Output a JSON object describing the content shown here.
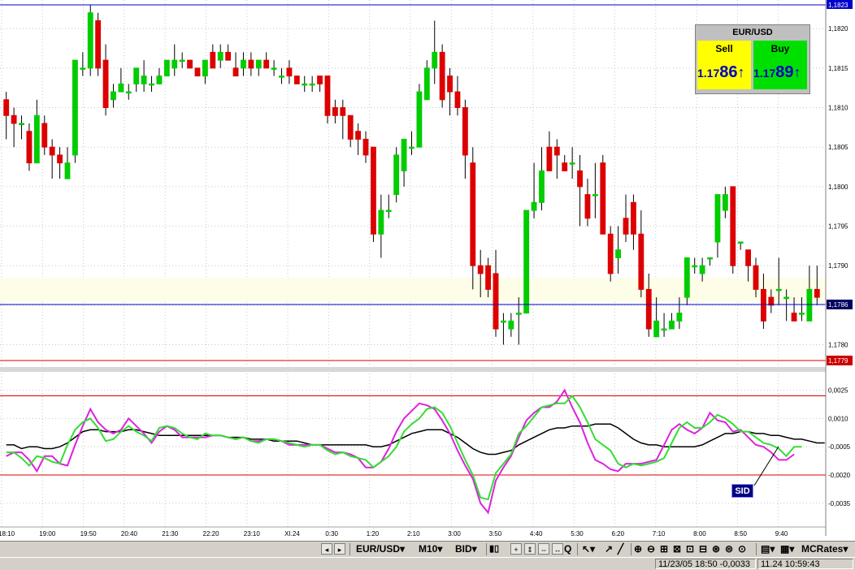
{
  "quote": {
    "symbol": "EUR/USD",
    "sell_label": "Sell",
    "buy_label": "Buy",
    "sell_prefix": "1.17",
    "sell_big": "86",
    "buy_prefix": "1.17",
    "buy_big": "89",
    "arrow": "↑"
  },
  "price_axis": {
    "labels": [
      "1,1820",
      "1,1815",
      "1,1810",
      "1,1805",
      "1,1800",
      "1,1795",
      "1,1790",
      "1,1785",
      "1,1780"
    ],
    "top_badge": "1,1823",
    "current_badge": "1,1786",
    "low_badge": "1,1779"
  },
  "indicator_axis": {
    "labels": [
      "0,0025",
      "0,0010",
      "-0,0005",
      "-0,0020",
      "-0,0035"
    ],
    "tag": "SID"
  },
  "time_axis": {
    "labels": [
      "18:10",
      "19:00",
      "19:50",
      "20:40",
      "21:30",
      "22:20",
      "23:10",
      "XI.24",
      "0:30",
      "1:20",
      "2:10",
      "3:00",
      "3:50",
      "4:40",
      "5:30",
      "6:20",
      "7:10",
      "8:00",
      "8:50",
      "9:40"
    ]
  },
  "toolbar": {
    "symbol": "EUR/USD",
    "timeframe": "M10",
    "price_type": "BID",
    "feed": "MCRates"
  },
  "status": {
    "info": "11/23/05 18:50  -0,0033",
    "clock": "11.24 10:59:43"
  },
  "colors": {
    "bull": "#00cc00",
    "bear": "#dd0000",
    "grid": "#c8c8c8",
    "sid_green": "#33dd33",
    "sid_magenta": "#dd22dd",
    "current_line": "#0000cc"
  },
  "chart_data": {
    "type": "candlestick",
    "symbol": "EUR/USD",
    "timeframe": "M10",
    "ylim": [
      1.1778,
      1.1823
    ],
    "candles": [
      [
        1.1811,
        1.1812,
        1.1806,
        1.1809
      ],
      [
        1.1809,
        1.181,
        1.1805,
        1.1808
      ],
      [
        1.1808,
        1.1809,
        1.1806,
        1.1808
      ],
      [
        1.1807,
        1.1808,
        1.1802,
        1.1803
      ],
      [
        1.1803,
        1.1811,
        1.1803,
        1.1809
      ],
      [
        1.1808,
        1.1809,
        1.1804,
        1.1805
      ],
      [
        1.1805,
        1.1806,
        1.1801,
        1.1804
      ],
      [
        1.1804,
        1.1805,
        1.1801,
        1.1803
      ],
      [
        1.1801,
        1.1805,
        1.1801,
        1.1803
      ],
      [
        1.1804,
        1.1814,
        1.1803,
        1.1816
      ],
      [
        1.1815,
        1.1817,
        1.1814,
        1.1815
      ],
      [
        1.1815,
        1.1823,
        1.1814,
        1.1822
      ],
      [
        1.1821,
        1.1822,
        1.1814,
        1.1815
      ],
      [
        1.1816,
        1.1818,
        1.1809,
        1.181
      ],
      [
        1.1811,
        1.1813,
        1.181,
        1.1812
      ],
      [
        1.1812,
        1.1815,
        1.1812,
        1.1813
      ],
      [
        1.1812,
        1.1813,
        1.1811,
        1.1812
      ],
      [
        1.1813,
        1.1815,
        1.1812,
        1.1815
      ],
      [
        1.1813,
        1.1816,
        1.1812,
        1.1814
      ],
      [
        1.1813,
        1.1814,
        1.1812,
        1.1813
      ],
      [
        1.1813,
        1.1815,
        1.1813,
        1.1814
      ],
      [
        1.1814,
        1.1816,
        1.1814,
        1.1816
      ],
      [
        1.1815,
        1.1818,
        1.1814,
        1.1816
      ],
      [
        1.1816,
        1.1817,
        1.1815,
        1.1816
      ],
      [
        1.1816,
        1.1816,
        1.1815,
        1.1815
      ],
      [
        1.1815,
        1.1815,
        1.1814,
        1.1814
      ],
      [
        1.1814,
        1.1816,
        1.1813,
        1.1816
      ],
      [
        1.1817,
        1.1818,
        1.1815,
        1.1815
      ],
      [
        1.1816,
        1.1818,
        1.1815,
        1.1817
      ],
      [
        1.1817,
        1.1818,
        1.1816,
        1.1816
      ],
      [
        1.1815,
        1.1817,
        1.1815,
        1.1814
      ],
      [
        1.1815,
        1.1817,
        1.1814,
        1.1816
      ],
      [
        1.1816,
        1.1817,
        1.1814,
        1.1815
      ],
      [
        1.1815,
        1.1816,
        1.1814,
        1.1816
      ],
      [
        1.1816,
        1.1817,
        1.1815,
        1.1815
      ],
      [
        1.1815,
        1.1816,
        1.1814,
        1.1815
      ],
      [
        1.1814,
        1.1815,
        1.1813,
        1.1814
      ],
      [
        1.1815,
        1.1816,
        1.1813,
        1.1814
      ],
      [
        1.1814,
        1.1814,
        1.1813,
        1.1813
      ],
      [
        1.1813,
        1.1814,
        1.1812,
        1.1813
      ],
      [
        1.1813,
        1.1814,
        1.1812,
        1.1813
      ],
      [
        1.1814,
        1.1814,
        1.1812,
        1.1813
      ],
      [
        1.1814,
        1.1814,
        1.1808,
        1.1809
      ],
      [
        1.181,
        1.1811,
        1.1808,
        1.1809
      ],
      [
        1.181,
        1.1811,
        1.1806,
        1.1809
      ],
      [
        1.1809,
        1.1809,
        1.1805,
        1.1806
      ],
      [
        1.1807,
        1.1808,
        1.1804,
        1.1806
      ],
      [
        1.1806,
        1.1807,
        1.1803,
        1.1804
      ],
      [
        1.1805,
        1.1805,
        1.1793,
        1.1794
      ],
      [
        1.1794,
        1.1799,
        1.1791,
        1.1797
      ],
      [
        1.1797,
        1.1799,
        1.1796,
        1.1797
      ],
      [
        1.1799,
        1.1805,
        1.1798,
        1.1804
      ],
      [
        1.1802,
        1.1806,
        1.18,
        1.1806
      ],
      [
        1.1805,
        1.1807,
        1.1804,
        1.1805
      ],
      [
        1.1805,
        1.1813,
        1.1805,
        1.1812
      ],
      [
        1.1811,
        1.1816,
        1.1811,
        1.1815
      ],
      [
        1.1815,
        1.1821,
        1.1813,
        1.1817
      ],
      [
        1.1817,
        1.1818,
        1.181,
        1.1811
      ],
      [
        1.1814,
        1.1815,
        1.1809,
        1.1812
      ],
      [
        1.1812,
        1.1814,
        1.1809,
        1.181
      ],
      [
        1.181,
        1.1811,
        1.1801,
        1.1804
      ],
      [
        1.1803,
        1.1805,
        1.1787,
        1.179
      ],
      [
        1.179,
        1.1792,
        1.1786,
        1.1789
      ],
      [
        1.179,
        1.1791,
        1.1786,
        1.1787
      ],
      [
        1.1789,
        1.1792,
        1.1781,
        1.1782
      ],
      [
        1.1783,
        1.1784,
        1.178,
        1.1783
      ],
      [
        1.1782,
        1.1784,
        1.1781,
        1.1783
      ],
      [
        1.1784,
        1.1786,
        1.178,
        1.1784
      ],
      [
        1.1784,
        1.1797,
        1.1784,
        1.1797
      ],
      [
        1.1797,
        1.1803,
        1.1796,
        1.1798
      ],
      [
        1.1798,
        1.1805,
        1.1797,
        1.1802
      ],
      [
        1.1805,
        1.1807,
        1.1802,
        1.1802
      ],
      [
        1.1805,
        1.1806,
        1.1801,
        1.1804
      ],
      [
        1.1803,
        1.1804,
        1.1802,
        1.1802
      ],
      [
        1.1803,
        1.1805,
        1.1801,
        1.1803
      ],
      [
        1.1802,
        1.1804,
        1.1795,
        1.18
      ],
      [
        1.1799,
        1.1801,
        1.1795,
        1.1796
      ],
      [
        1.1799,
        1.1803,
        1.1796,
        1.1799
      ],
      [
        1.1803,
        1.1804,
        1.1795,
        1.1794
      ],
      [
        1.1794,
        1.1795,
        1.1788,
        1.1789
      ],
      [
        1.1791,
        1.1795,
        1.1789,
        1.1792
      ],
      [
        1.1796,
        1.1799,
        1.1793,
        1.1794
      ],
      [
        1.1798,
        1.1799,
        1.1792,
        1.1794
      ],
      [
        1.1794,
        1.1797,
        1.1786,
        1.1787
      ],
      [
        1.1787,
        1.1789,
        1.1781,
        1.1782
      ],
      [
        1.1781,
        1.1786,
        1.1781,
        1.1783
      ],
      [
        1.1782,
        1.1784,
        1.1781,
        1.1782
      ],
      [
        1.1782,
        1.1784,
        1.1782,
        1.1783
      ],
      [
        1.1783,
        1.1786,
        1.1782,
        1.1784
      ],
      [
        1.1786,
        1.179,
        1.1785,
        1.1791
      ],
      [
        1.179,
        1.1791,
        1.1789,
        1.179
      ],
      [
        1.1789,
        1.1791,
        1.1788,
        1.179
      ],
      [
        1.1791,
        1.1791,
        1.179,
        1.1791
      ],
      [
        1.1793,
        1.1799,
        1.1791,
        1.1799
      ],
      [
        1.1797,
        1.18,
        1.1796,
        1.1799
      ],
      [
        1.18,
        1.18,
        1.1789,
        1.179
      ],
      [
        1.1793,
        1.1793,
        1.1792,
        1.1793
      ],
      [
        1.1792,
        1.1792,
        1.1788,
        1.179
      ],
      [
        1.179,
        1.1791,
        1.1786,
        1.1787
      ],
      [
        1.1787,
        1.1789,
        1.1782,
        1.1783
      ],
      [
        1.1786,
        1.1787,
        1.1784,
        1.1785
      ],
      [
        1.1787,
        1.1791,
        1.1785,
        1.1787
      ],
      [
        1.1786,
        1.1787,
        1.1783,
        1.1786
      ],
      [
        1.1784,
        1.1786,
        1.1783,
        1.1783
      ],
      [
        1.1784,
        1.1786,
        1.1783,
        1.1784
      ],
      [
        1.1783,
        1.179,
        1.1783,
        1.1787
      ],
      [
        1.1787,
        1.179,
        1.1785,
        1.1786
      ]
    ],
    "current_price": 1.1786,
    "low_line": 1.1779,
    "top_line": 1.1823,
    "indicator": {
      "name": "SID",
      "ylim": [
        -0.0042,
        0.003
      ],
      "levels": [
        0.0022,
        -0.002
      ],
      "black": [
        -0.0004,
        -0.0004,
        -0.0006,
        -0.0005,
        -0.0005,
        -0.0006,
        -0.0006,
        -0.0005,
        -0.0003,
        0.0,
        0.0003,
        0.0004,
        0.0004,
        0.0003,
        0.0003,
        0.0003,
        0.0004,
        0.0004,
        0.0003,
        0.0002,
        0.0001,
        0.0001,
        0.0001,
        0.0001,
        0.0001,
        0.0001,
        0.0001,
        0.0001,
        0.0001,
        0.0,
        0.0,
        0.0,
        -0.0001,
        -0.0001,
        -0.0001,
        -0.0002,
        -0.0002,
        -0.0002,
        -0.0002,
        -0.0003,
        -0.0004,
        -0.0004,
        -0.0004,
        -0.0004,
        -0.0004,
        -0.0004,
        -0.0004,
        -0.0004,
        -0.0005,
        -0.0005,
        -0.0004,
        -0.0002,
        0.0,
        0.0002,
        0.0003,
        0.0004,
        0.0004,
        0.0004,
        0.0002,
        0.0,
        -0.0003,
        -0.0006,
        -0.0008,
        -0.0009,
        -0.0009,
        -0.0008,
        -0.0007,
        -0.0004,
        -0.0002,
        0.0,
        0.0002,
        0.0004,
        0.0005,
        0.0005,
        0.0006,
        0.0006,
        0.0006,
        0.0007,
        0.0007,
        0.0007,
        0.0005,
        0.0002,
        -0.0001,
        -0.0003,
        -0.0004,
        -0.0004,
        -0.0005,
        -0.0005,
        -0.0005,
        -0.0005,
        -0.0005,
        -0.0004,
        -0.0002,
        0.0,
        0.0002,
        0.0002,
        0.0003,
        0.0003,
        0.0002,
        0.0002,
        0.0001,
        0.0001,
        0.0,
        -0.0001,
        -0.0001,
        -0.0002,
        -0.0003,
        -0.0003
      ],
      "green": [
        -0.0008,
        -0.0008,
        -0.0011,
        -0.0015,
        -0.001,
        -0.0011,
        -0.0013,
        -0.0014,
        -0.0004,
        0.0004,
        0.0008,
        0.001,
        0.0005,
        -0.0002,
        -0.0001,
        0.0003,
        0.0006,
        0.0003,
        0.0001,
        -0.0002,
        0.0005,
        0.0006,
        0.0005,
        0.0002,
        0.0,
        -0.0001,
        0.0002,
        0.0001,
        0.0001,
        0.0,
        -0.0001,
        0.0,
        -0.0002,
        -0.0003,
        -0.0001,
        -0.0001,
        -0.0002,
        -0.0003,
        -0.0004,
        -0.0005,
        -0.0004,
        -0.0004,
        -0.0007,
        -0.0009,
        -0.0008,
        -0.001,
        -0.0011,
        -0.0012,
        -0.0016,
        -0.0013,
        -0.001,
        -0.0005,
        0.0003,
        0.0007,
        0.001,
        0.0015,
        0.0016,
        0.0013,
        0.0006,
        -0.0003,
        -0.0012,
        -0.002,
        -0.0032,
        -0.0033,
        -0.0019,
        -0.0014,
        -0.0009,
        0.0002,
        0.0006,
        0.0011,
        0.0016,
        0.0017,
        0.0018,
        0.0018,
        0.0022,
        0.0016,
        0.0008,
        -0.0001,
        -0.0004,
        -0.0007,
        -0.0014,
        -0.0016,
        -0.0014,
        -0.0015,
        -0.0014,
        -0.0013,
        -0.0011,
        -0.0003,
        0.0005,
        0.0008,
        0.0005,
        0.0005,
        0.0008,
        0.0012,
        0.001,
        0.0007,
        0.0003,
        0.0003,
        0.0,
        -0.0003,
        -0.0004,
        -0.0006,
        -0.001,
        -0.0005,
        -0.0005
      ],
      "magenta": [
        -0.001,
        -0.0008,
        -0.0008,
        -0.0012,
        -0.0018,
        -0.001,
        -0.001,
        -0.0014,
        -0.0015,
        -0.0004,
        0.0006,
        0.0015,
        0.0008,
        0.0004,
        0.0002,
        0.0004,
        0.001,
        0.0006,
        0.0002,
        -0.0003,
        0.0003,
        0.0006,
        0.0004,
        0.0,
        0.0,
        0.0,
        0.0,
        0.0001,
        0.0001,
        0.0,
        -0.0001,
        0.0,
        -0.0002,
        -0.0002,
        -0.0001,
        -0.0001,
        -0.0002,
        -0.0004,
        -0.0004,
        -0.0004,
        -0.0004,
        -0.0004,
        -0.0006,
        -0.0008,
        -0.0008,
        -0.0009,
        -0.0011,
        -0.0016,
        -0.0016,
        -0.0013,
        -0.0006,
        0.0003,
        0.001,
        0.0014,
        0.0018,
        0.0017,
        0.0015,
        0.0009,
        0.0002,
        -0.0007,
        -0.0015,
        -0.0022,
        -0.0035,
        -0.004,
        -0.0023,
        -0.0016,
        -0.001,
        0.0,
        0.0009,
        0.0013,
        0.0016,
        0.0016,
        0.0019,
        0.0025,
        0.0016,
        0.0008,
        -0.0003,
        -0.0012,
        -0.0014,
        -0.0017,
        -0.0018,
        -0.0014,
        -0.0014,
        -0.0014,
        -0.0013,
        -0.0012,
        -0.0004,
        0.0004,
        0.0007,
        0.0004,
        0.0002,
        0.0005,
        0.0013,
        0.0009,
        0.0008,
        0.0003,
        0.0004,
        0.0,
        -0.0004,
        -0.0005,
        -0.0008,
        -0.0012,
        -0.0012,
        -0.0009
      ]
    }
  }
}
